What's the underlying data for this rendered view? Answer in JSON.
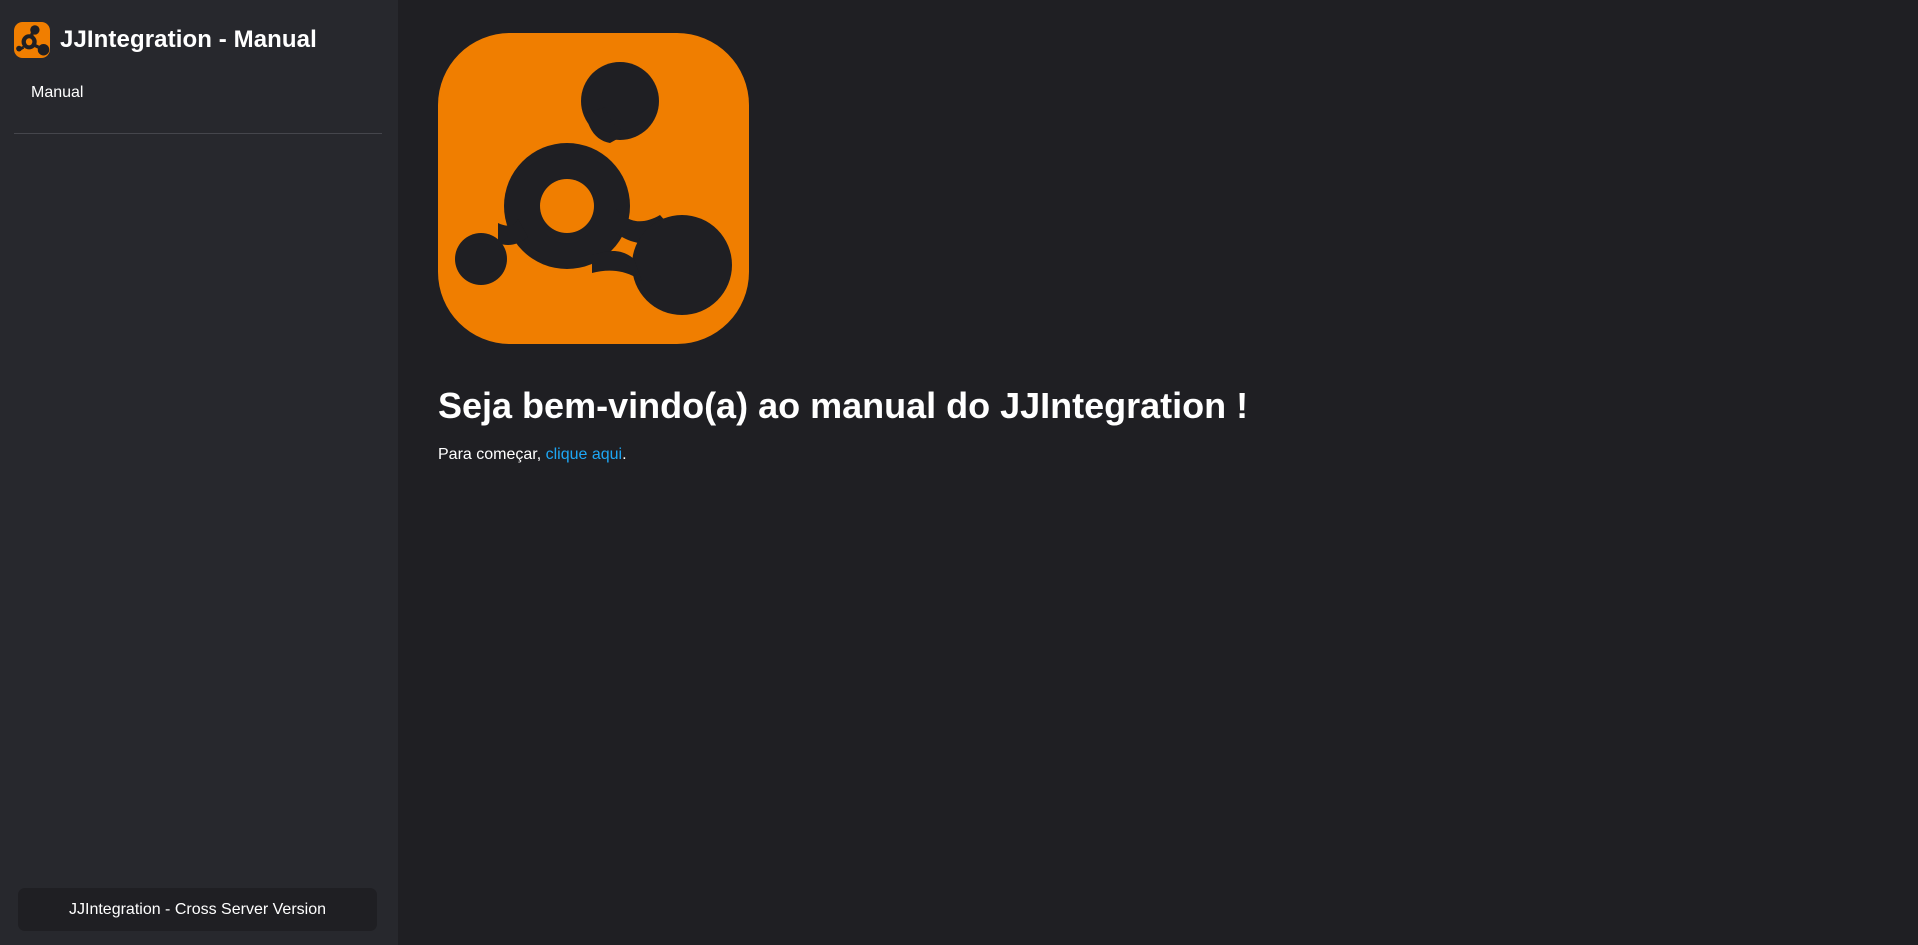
{
  "sidebar": {
    "brand": {
      "logo_icon": "jjintegration-logo-icon",
      "title": "JJIntegration - Manual"
    },
    "nav_items": [
      {
        "label": "Manual"
      }
    ],
    "version_label": "JJIntegration - Cross Server Version"
  },
  "main": {
    "hero_logo_icon": "jjintegration-logo-icon",
    "title": "Seja bem-vindo(a) ao manual do JJIntegration !",
    "intro": {
      "prefix": "Para começar, ",
      "link_label": "clique aqui",
      "suffix": "."
    }
  },
  "colors": {
    "brand_orange": "#f07e00",
    "background": "#1f1f23",
    "sidebar": "#27282d",
    "link": "#1ea7f5"
  }
}
